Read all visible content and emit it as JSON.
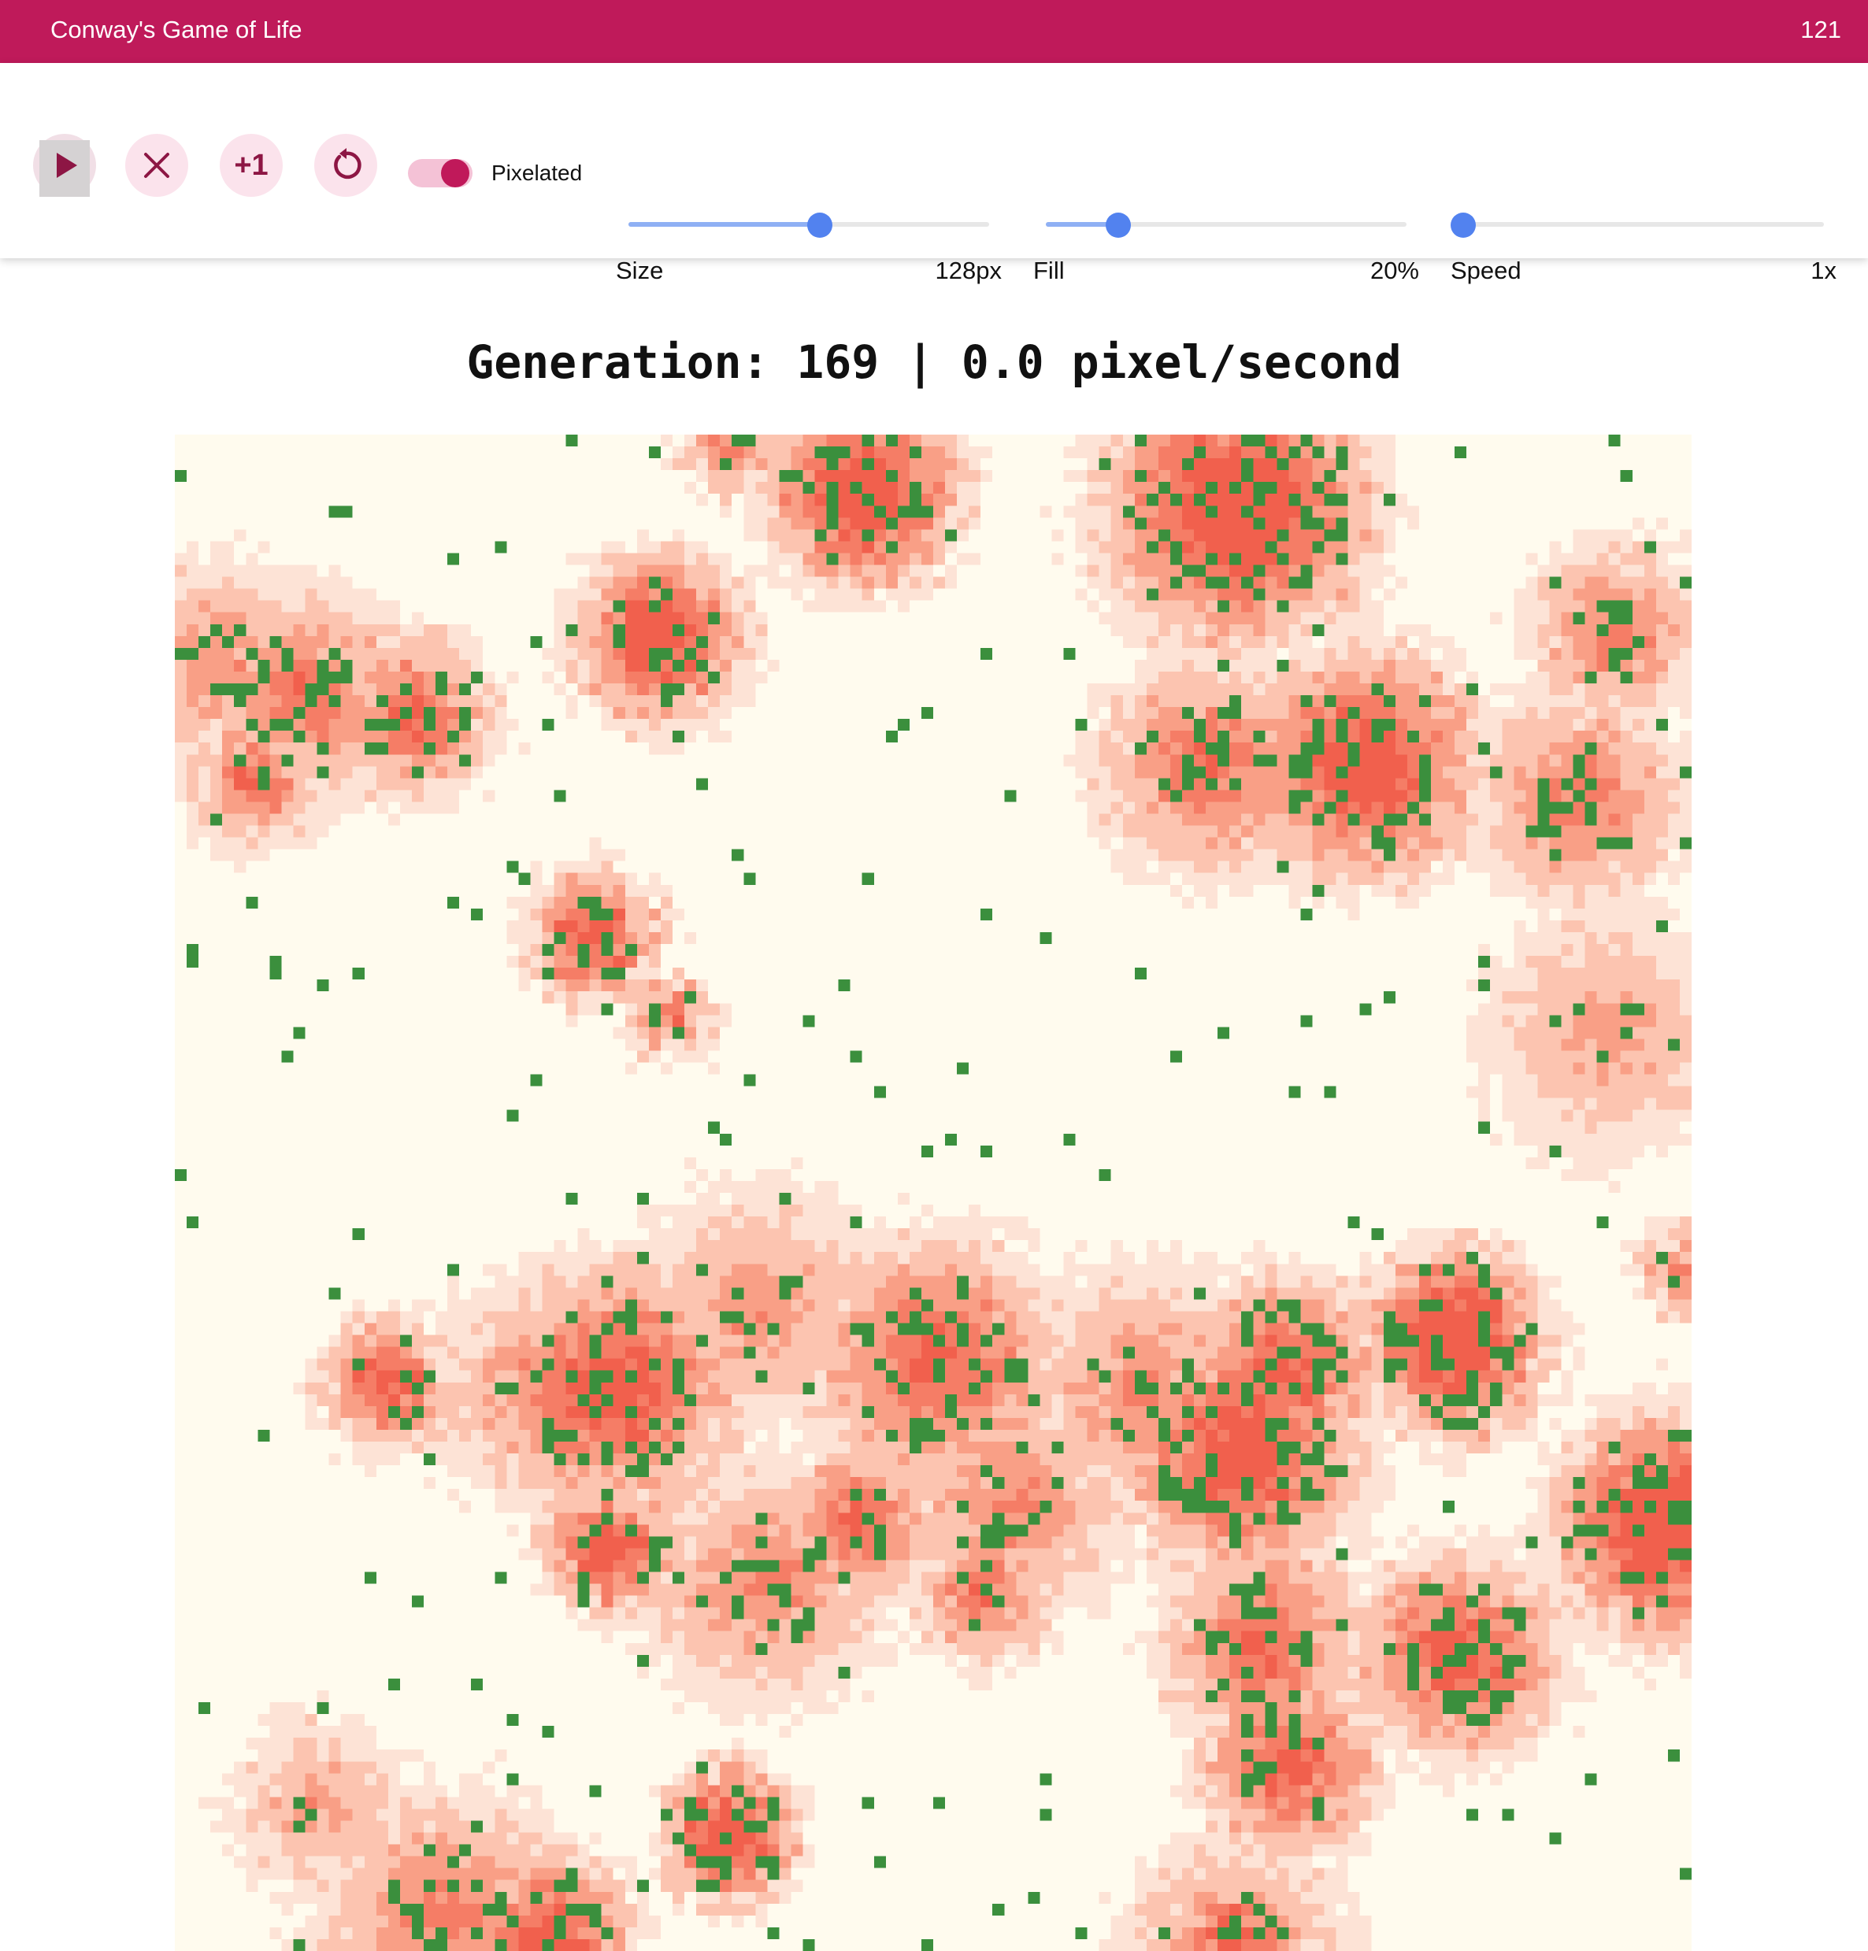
{
  "app": {
    "title": "Conway's Game of Life",
    "counter": "121"
  },
  "controls": {
    "play_icon": "play-icon",
    "clear_icon": "close-icon",
    "step_label": "+1",
    "reset_icon": "reset-icon",
    "pixelated": {
      "label": "Pixelated",
      "on": true
    }
  },
  "sliders": {
    "size": {
      "label": "Size",
      "value": "128px",
      "level": 0.53
    },
    "fill": {
      "label": "Fill",
      "value": "20%",
      "level": 0.2
    },
    "speed": {
      "label": "Speed",
      "value": "1x",
      "level": 0.0
    }
  },
  "status": {
    "text": "Generation: 169 | 0.0 pixel/second"
  },
  "board": {
    "cells_per_side": 128,
    "live_color": "#3b8f3d",
    "age_palette": [
      "#fffbee",
      "#fde3d6",
      "#fcc4b0",
      "#f99f86",
      "#f57d66",
      "#f1604d"
    ]
  },
  "colors": {
    "appbar": "#bf1a5a",
    "accent": "#5282ef",
    "toggle": "#c0195a"
  }
}
